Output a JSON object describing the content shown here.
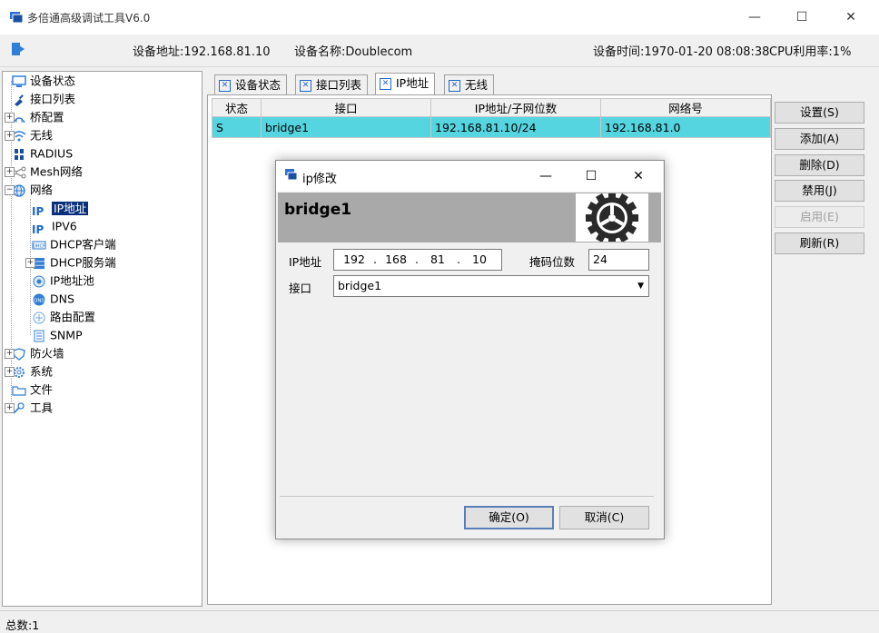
{
  "window": {
    "title": "多倍通高级调试工具V6.0",
    "minimize": "—",
    "maximize": "☐",
    "close": "✕"
  },
  "header": {
    "device_address": "设备地址:192.168.81.10",
    "device_name": "设备名称:Doublecom",
    "device_time": "设备时间:1970-01-20 08:08:38",
    "cpu_usage": "CPU利用率:1%"
  },
  "tree": [
    {
      "label": "设备状态",
      "icon": "monitor-icon"
    },
    {
      "label": "接口列表",
      "icon": "plug-icon"
    },
    {
      "label": "桥配置",
      "icon": "bridge-icon"
    },
    {
      "label": "无线",
      "icon": "wifi-icon"
    },
    {
      "label": "RADIUS",
      "icon": "grid-icon"
    },
    {
      "label": "Mesh网络",
      "icon": "share-icon"
    },
    {
      "label": "网络",
      "icon": "globe-icon"
    },
    {
      "label": "IP地址",
      "icon": "ip-icon",
      "icon_text": "IP"
    },
    {
      "label": "IPV6",
      "icon": "ipv6-icon",
      "icon_text": "IP"
    },
    {
      "label": "DHCP客户端",
      "icon": "dhcp-icon"
    },
    {
      "label": "DHCP服务端",
      "icon": "server-icon"
    },
    {
      "label": "IP地址池",
      "icon": "pool-icon"
    },
    {
      "label": "DNS",
      "icon": "dns-icon"
    },
    {
      "label": "路由配置",
      "icon": "route-icon"
    },
    {
      "label": "SNMP",
      "icon": "document-icon"
    },
    {
      "label": "防火墙",
      "icon": "shield-icon"
    },
    {
      "label": "系统",
      "icon": "gear-icon"
    },
    {
      "label": "文件",
      "icon": "folder-icon"
    },
    {
      "label": "工具",
      "icon": "wrench-icon"
    }
  ],
  "tabs": [
    {
      "label": "设备状态"
    },
    {
      "label": "接口列表"
    },
    {
      "label": "IP地址",
      "active": true
    },
    {
      "label": "无线"
    }
  ],
  "table": {
    "columns": [
      "状态",
      "接口",
      "IP地址/子网位数",
      "网络号"
    ],
    "rows": [
      {
        "status": "S",
        "interface": "bridge1",
        "ip": "192.168.81.10/24",
        "network": "192.168.81.0"
      }
    ]
  },
  "side_buttons": [
    {
      "label": "设置(S)",
      "enabled": true
    },
    {
      "label": "添加(A)",
      "enabled": true
    },
    {
      "label": "删除(D)",
      "enabled": true
    },
    {
      "label": "禁用(J)",
      "enabled": true
    },
    {
      "label": "启用(E)",
      "enabled": false
    },
    {
      "label": "刷新(R)",
      "enabled": true
    }
  ],
  "status": {
    "total": "总数:1"
  },
  "dialog": {
    "title": "ip修改",
    "heading": "bridge1",
    "ip_label": "IP地址",
    "ip": [
      "192",
      "168",
      "81",
      "10"
    ],
    "ip_dot": ".",
    "mask_label": "掩码位数",
    "mask": "24",
    "interface_label": "接口",
    "interface_value": "bridge1",
    "ok": "确定(O)",
    "cancel": "取消(C)"
  },
  "colors": {
    "selected_row": "#55d5e0",
    "tree_selection": "#0a2f7a",
    "tab_icon": "#1f66c9",
    "banner": "#a9a9a9"
  }
}
